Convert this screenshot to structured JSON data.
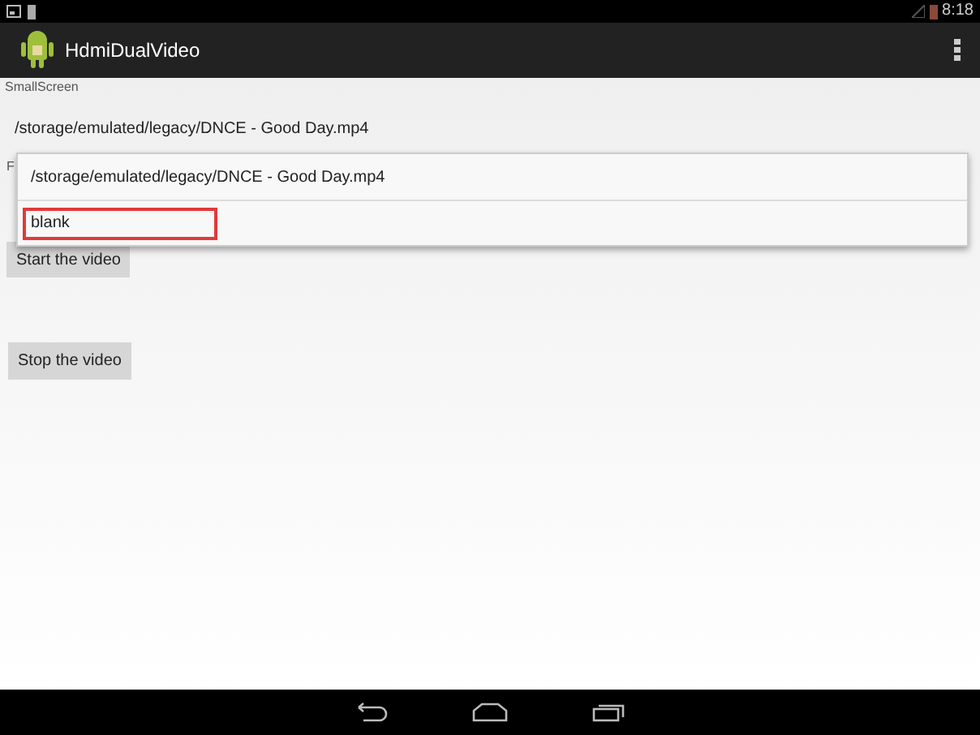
{
  "status_bar": {
    "time": "8:18"
  },
  "action_bar": {
    "title": "HdmiDualVideo"
  },
  "small_screen": {
    "label": "SmallScreen",
    "value": "/storage/emulated/legacy/DNCE - Good Day.mp4"
  },
  "second_label": "F",
  "dropdown": {
    "items": [
      {
        "label": "/storage/emulated/legacy/DNCE - Good Day.mp4",
        "selected": false
      },
      {
        "label": "blank",
        "selected": true
      }
    ]
  },
  "buttons": [
    "Start the video",
    "Stop the video"
  ]
}
